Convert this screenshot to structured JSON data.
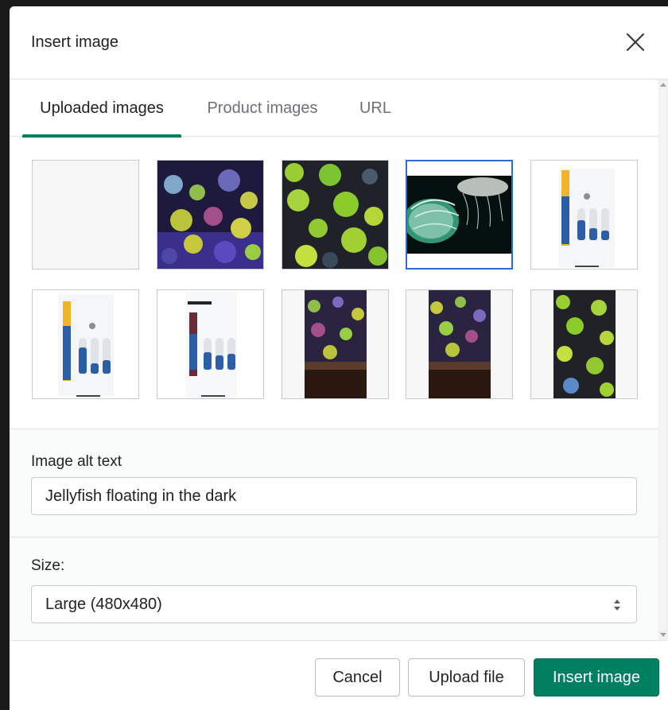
{
  "modal": {
    "title": "Insert image",
    "close_icon": "close-icon"
  },
  "tabs": [
    {
      "label": "Uploaded images",
      "active": true
    },
    {
      "label": "Product images",
      "active": false
    },
    {
      "label": "URL",
      "active": false
    }
  ],
  "images": [
    {
      "kind": "blank",
      "selected": false
    },
    {
      "kind": "reef-purple",
      "selected": false
    },
    {
      "kind": "reef-green",
      "selected": false
    },
    {
      "kind": "jellyfish",
      "selected": true
    },
    {
      "kind": "app-screen-1",
      "selected": false
    },
    {
      "kind": "app-screen-2",
      "selected": false
    },
    {
      "kind": "app-screen-customize",
      "selected": false
    },
    {
      "kind": "reef-tall-1",
      "selected": false
    },
    {
      "kind": "reef-tall-2",
      "selected": false
    },
    {
      "kind": "reef-tall-3",
      "selected": false
    }
  ],
  "alt_text": {
    "label": "Image alt text",
    "value": "Jellyfish floating in the dark"
  },
  "size": {
    "label": "Size:",
    "selected": "Large (480x480)"
  },
  "footer": {
    "cancel_label": "Cancel",
    "upload_label": "Upload file",
    "insert_label": "Insert image"
  },
  "colors": {
    "accent": "#008060",
    "selected_border": "#2c6ecb"
  }
}
